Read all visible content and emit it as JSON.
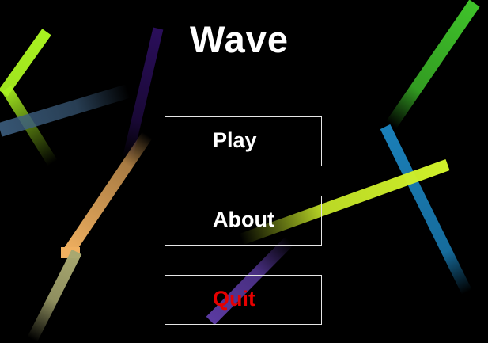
{
  "title": "Wave",
  "menu": {
    "play_label": "Play",
    "about_label": "About",
    "quit_label": "Quit"
  },
  "colors": {
    "background": "#000000",
    "title_text": "#ffffff",
    "button_border": "#e6e6e6",
    "play_text": "#ffffff",
    "about_text": "#ffffff",
    "quit_text": "#e60000",
    "streak_lime": "#a8f020",
    "streak_slate_blue": "#3d5f80",
    "streak_dark_purple": "#2a0e5a",
    "streak_orange": "#f0b060",
    "streak_olive": "#a8a870",
    "streak_green": "#3fc22a",
    "streak_cyan_blue": "#1a7fb8",
    "streak_yellow_green": "#cff02a",
    "streak_purple": "#5a3aa0"
  }
}
